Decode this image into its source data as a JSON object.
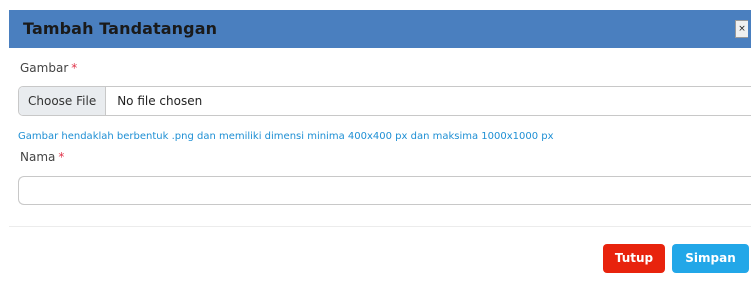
{
  "modal": {
    "title": "Tambah Tandatangan",
    "close_icon": "×"
  },
  "form": {
    "image_field": {
      "label": "Gambar",
      "required_marker": "*",
      "button_label": "Choose File",
      "status": "No file chosen",
      "help_text": "Gambar hendaklah berbentuk .png dan memiliki dimensi minima 400x400 px dan maksima 1000x1000 px"
    },
    "name_field": {
      "label": "Nama",
      "required_marker": "*",
      "value": ""
    }
  },
  "footer": {
    "close_label": "Tutup",
    "save_label": "Simpan"
  },
  "colors": {
    "header_bg": "#4a7fbf",
    "help_text": "#1e8fd4",
    "required": "#e0344a",
    "close_button": "#e8230d",
    "save_button": "#22a7e8"
  }
}
